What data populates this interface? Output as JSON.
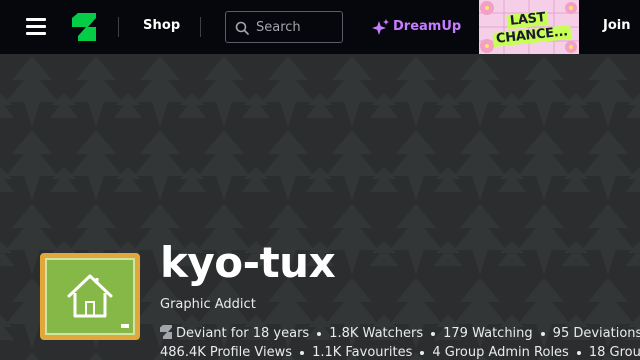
{
  "colors": {
    "topbar_bg": "#06070d",
    "page_bg": "#2b2d2e",
    "brand_green": "#05cc47",
    "dreamup_purple": "#c77dff",
    "promo_lime": "#c8ff55"
  },
  "topbar": {
    "menu_icon": "hamburger-menu-icon",
    "logo_icon": "deviantart-logo-icon",
    "shop_label": "Shop",
    "search_placeholder": "Search",
    "search_icon": "search-icon",
    "dreamup_label": "DreamUp",
    "dreamup_icon": "sparkle-icon",
    "promo_line1": "LAST",
    "promo_line2": "CHANCE...",
    "join_label": "Join"
  },
  "profile": {
    "avatar_icon": "house-icon",
    "username": "kyo-tux",
    "tagline": "Graphic Addict",
    "stats_line1": [
      "Deviant for 18 years",
      "1.8K Watchers",
      "179 Watching",
      "95 Deviations"
    ],
    "stats_line2": [
      "486.4K Profile Views",
      "1.1K Favourites",
      "4 Group Admin Roles",
      "18 Group"
    ]
  }
}
